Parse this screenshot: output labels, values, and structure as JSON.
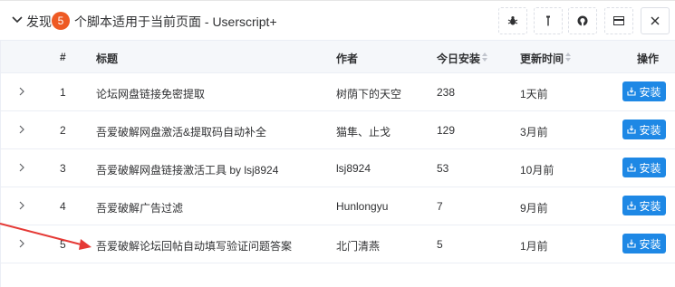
{
  "header": {
    "prefix": "发现",
    "count": "5",
    "suffix": "个脚本适用于当前页面 - Userscript+",
    "buttons": [
      "bug-icon",
      "pin-icon",
      "github-icon",
      "window-icon",
      "close-icon"
    ]
  },
  "table": {
    "columns": {
      "index": "#",
      "title": "标题",
      "author": "作者",
      "today": "今日安装",
      "updated": "更新时间",
      "action": "操作"
    },
    "rows": [
      {
        "index": "1",
        "title": "论坛网盘链接免密提取",
        "author": "树荫下的天空",
        "today": "238",
        "updated": "1天前",
        "action": "安装"
      },
      {
        "index": "2",
        "title": "吾爱破解网盘激活&提取码自动补全",
        "author": "猫隼、止戈",
        "today": "129",
        "updated": "3月前",
        "action": "安装"
      },
      {
        "index": "3",
        "title": "吾爱破解网盘链接激活工具 by lsj8924",
        "author": "lsj8924",
        "today": "53",
        "updated": "10月前",
        "action": "安装"
      },
      {
        "index": "4",
        "title": "吾爱破解广告过滤",
        "author": "Hunlongyu",
        "today": "7",
        "updated": "9月前",
        "action": "安装"
      },
      {
        "index": "5",
        "title": "吾爱破解论坛回帖自动填写验证问题答案",
        "author": "北门清燕",
        "today": "5",
        "updated": "1月前",
        "action": "安装"
      }
    ]
  },
  "colors": {
    "badge": "#ee5a24",
    "install_button": "#1e88e5",
    "annotation_arrow": "#e53935"
  }
}
